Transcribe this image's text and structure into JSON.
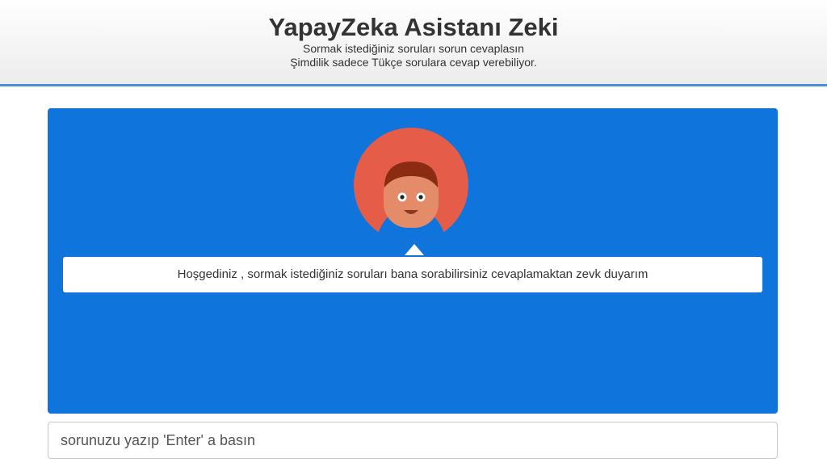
{
  "header": {
    "title": "YapayZeka Asistanı Zeki",
    "subtitle_line1": "Sormak istediğiniz soruları sorun cevaplasın",
    "subtitle_line2": "Şimdilik sadece Tükçe sorulara cevap verebiliyor."
  },
  "chat": {
    "avatar_icon": "assistant-avatar-icon",
    "message": "Hoşgediniz , sormak istediğiniz soruları bana sorabilirsiniz cevaplamaktan zevk duyarım"
  },
  "input": {
    "placeholder": "sorunuzu yazıp 'Enter' a basın",
    "value": ""
  },
  "colors": {
    "panel_background": "#0f74dc",
    "avatar_background": "#e55d48",
    "header_border": "#4a90d9"
  }
}
